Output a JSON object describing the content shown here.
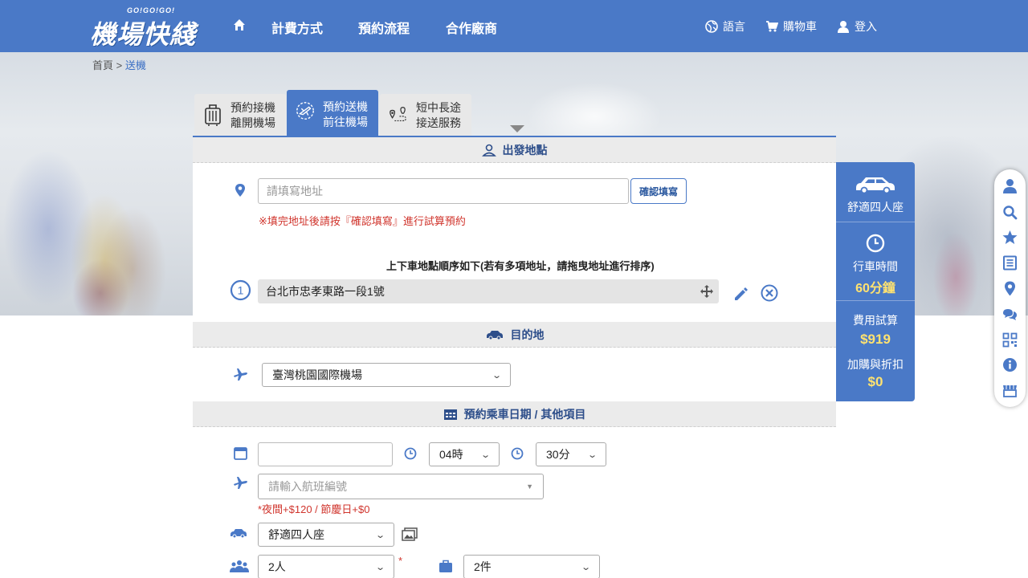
{
  "header": {
    "logo_small": "GO!GO!GO!",
    "logo_main": "機場快綫",
    "nav": [
      "計費方式",
      "預約流程",
      "合作廠商"
    ],
    "language": "語言",
    "cart": "購物車",
    "login": "登入"
  },
  "breadcrumb": {
    "home": "首頁",
    "separator": ">",
    "current": "送機"
  },
  "tabs": [
    {
      "line1": "預約接機",
      "line2": "離開機場",
      "icon": "luggage-icon",
      "active": false
    },
    {
      "line1": "預約送機",
      "line2": "前往機場",
      "icon": "airport-icon",
      "active": true
    },
    {
      "line1": "短中長途",
      "line2": "接送服務",
      "icon": "route-icon",
      "active": false
    }
  ],
  "departure": {
    "heading": "出發地點",
    "address_placeholder": "請填寫地址",
    "confirm_button": "確認填寫",
    "note": "※填完地址後請按『確認填寫』進行試算預約",
    "order_title": "上下車地點順序如下(若有多項地址，請拖曳地址進行排序)",
    "items": [
      {
        "index": "1",
        "address": "台北市忠孝東路一段1號"
      }
    ]
  },
  "destination": {
    "heading": "目的地",
    "airport": "臺灣桃園國際機場"
  },
  "booking": {
    "heading": "預約乘車日期 / 其他項目",
    "date_value": "",
    "hour": "04時",
    "minute": "30分",
    "flight_placeholder": "請輸入航班編號",
    "surcharge_note": "*夜間+$120 / 節慶日+$0",
    "car_type": "舒適四人座",
    "passengers": "2人",
    "required_mark": "*",
    "luggage": "2件"
  },
  "summary": {
    "car_type": "舒適四人座",
    "travel_time_label": "行車時間",
    "travel_time_value": "60分鐘",
    "fare_label": "費用試算",
    "fare_value": "$919",
    "extras_label": "加購與折扣",
    "extras_value": "$0"
  },
  "colors": {
    "brand_blue": "#4a79c7",
    "highlight_yellow": "#ffe270",
    "warning_red": "#d0342c"
  }
}
